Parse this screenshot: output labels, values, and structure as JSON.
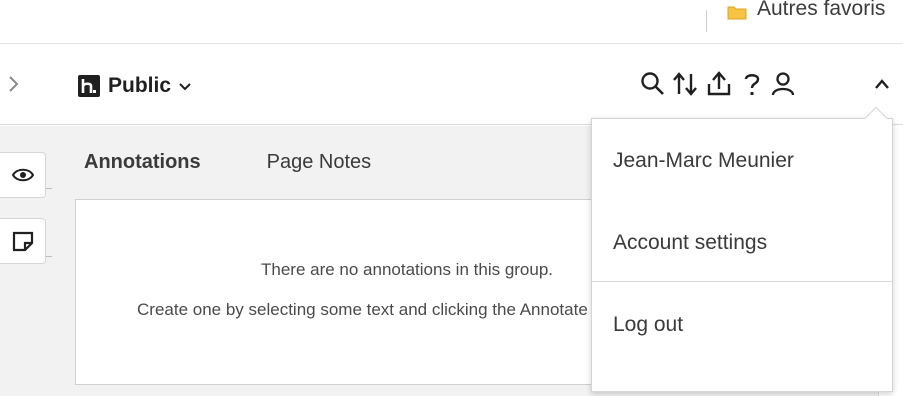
{
  "bookmarks": {
    "folder_label": "Autres favoris",
    "folder_color": "#f6c343"
  },
  "topbar": {
    "group_name": "Public",
    "icons": [
      "search-icon",
      "sort-icon",
      "share-icon",
      "help-icon",
      "user-icon",
      "chevron-up-icon"
    ]
  },
  "tabs": {
    "annotations": "Annotations",
    "page_notes": "Page Notes"
  },
  "empty_state": {
    "line1": "There are no annotations in this group.",
    "line2": "Create one by selecting some text and clicking the Annotate button."
  },
  "user_menu": {
    "username": "Jean-Marc Meunier",
    "account_settings": "Account settings",
    "log_out": "Log out"
  },
  "colors": {
    "accent": "#202020",
    "panel_bg": "#f2f2f2",
    "border": "#d4d4d4"
  }
}
